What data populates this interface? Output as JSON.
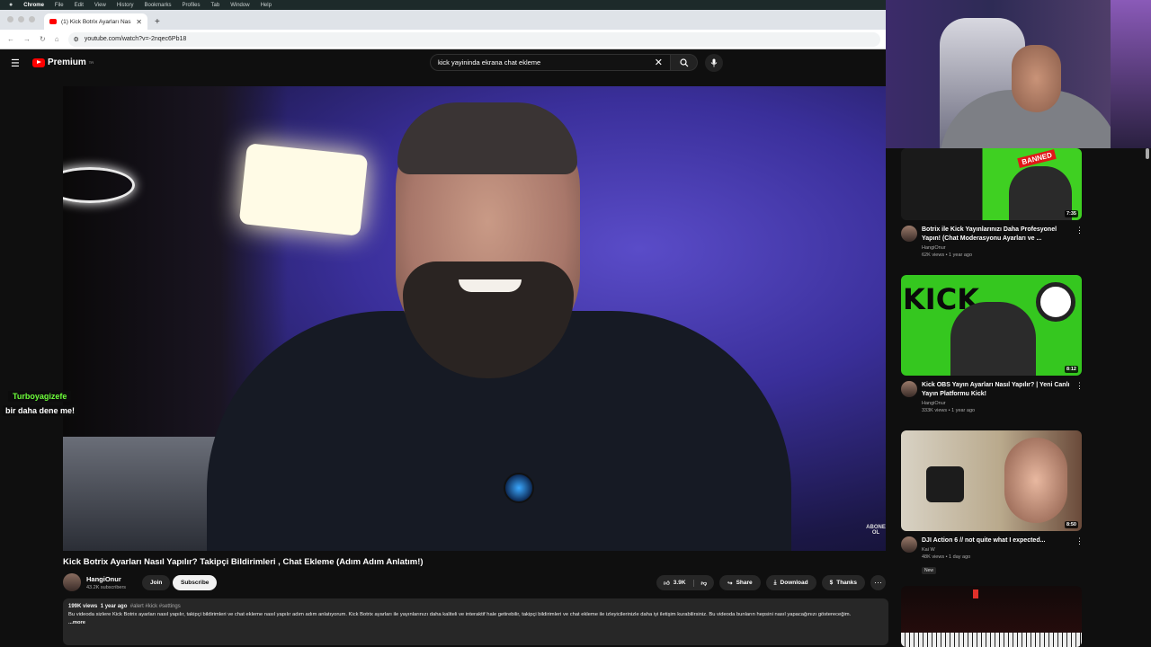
{
  "menubar": {
    "app": "Chrome",
    "items": [
      "File",
      "Edit",
      "View",
      "History",
      "Bookmarks",
      "Profiles",
      "Tab",
      "Window",
      "Help"
    ]
  },
  "browser": {
    "tab_title": "(1) Kick Botrix Ayarları Nasıl Y",
    "url": "youtube.com/watch?v=-2nqec6Pb18"
  },
  "youtube": {
    "logo_text": "Premium",
    "logo_sup": "TR",
    "search_query": "kick yayininda ekrana chat ekleme"
  },
  "video": {
    "watermark": "ABONE OL"
  },
  "chat_overlay": {
    "username": "Turboyagizefe",
    "message": "bir daha dene me!"
  },
  "info": {
    "title": "Kick Botrix Ayarları Nasıl Yapılır? Takipçi Bildirimleri , Chat Ekleme (Adım Adım Anlatım!)",
    "channel": "HangiOnur",
    "subscribers": "43.2K subscribers",
    "join_label": "Join",
    "subscribe_label": "Subscribe",
    "likes": "3.9K",
    "share_label": "Share",
    "download_label": "Download",
    "thanks_label": "Thanks"
  },
  "description": {
    "views": "199K views",
    "age": "1 year ago",
    "tags": "#alert #kick #settings",
    "text": "Bu videoda sizlere Kick Botrix ayarları nasıl yapılır, takipçi bildirimleri ve chat ekleme nasıl yapılır adım adım anlatıyorum. Kick Botrix ayarları ile yayınlarınızı daha kaliteli ve interaktif hale getirebilir, takipçi bildirimleri ve chat ekleme ile izleyicilerinizle daha iyi iletişim kurabilirsiniz. Bu videoda bunların hepsini nasıl yapacağınızı göstereceğim.",
    "more": "...more"
  },
  "recommendations": [
    {
      "title": "Botrix ile Kick Yayınlarınızı Daha Profesyonel Yapın! (Chat Moderasyonu Ayarları ve ...",
      "channel": "HangiOnur",
      "meta": "62K views • 1 year ago",
      "duration": "7:35",
      "thumb_label": "BANNED",
      "new": ""
    },
    {
      "title": "Kick OBS Yayın Ayarları Nasıl Yapılır? | Yeni Canlı Yayın Platformu Kick!",
      "channel": "HangiOnur",
      "meta": "333K views • 1 year ago",
      "duration": "8:12",
      "thumb_label": "KICK",
      "new": ""
    },
    {
      "title": "DJI Action 6 // not quite what I expected...",
      "channel": "Kai W",
      "meta": "48K views • 1 day ago",
      "duration": "8:50",
      "thumb_label": "",
      "new": "New"
    }
  ]
}
